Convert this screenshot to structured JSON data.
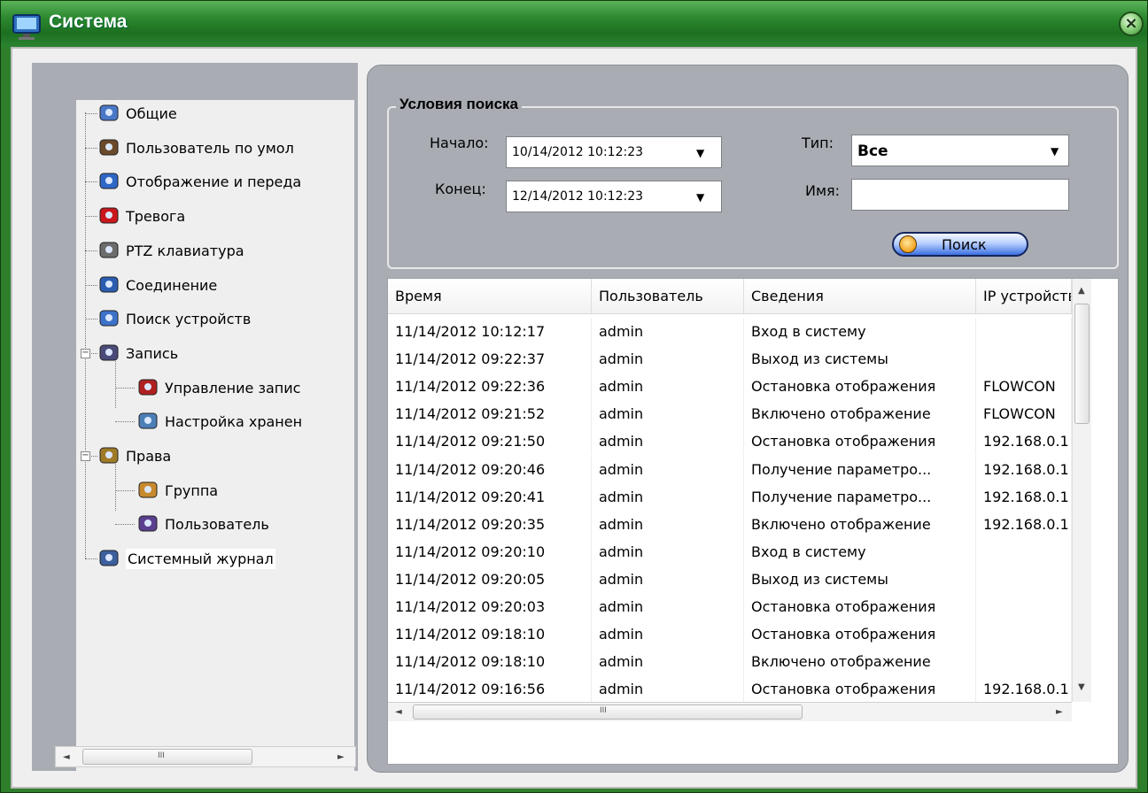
{
  "window": {
    "title": "Система",
    "close_glyph": "×",
    "icons": {
      "title": "monitor-icon",
      "close": "close-icon"
    }
  },
  "tree": {
    "items": [
      {
        "label": "Общие",
        "icon": "general-settings-icon"
      },
      {
        "label": "Пользователь по умол",
        "icon": "default-user-icon"
      },
      {
        "label": "Отображение и переда",
        "icon": "display-icon"
      },
      {
        "label": "Тревога",
        "icon": "alarm-icon"
      },
      {
        "label": "PTZ клавиатура",
        "icon": "ptz-keyboard-icon"
      },
      {
        "label": "Соединение",
        "icon": "connection-icon"
      },
      {
        "label": "Поиск устройств",
        "icon": "device-search-icon"
      },
      {
        "label": "Запись",
        "icon": "recording-icon",
        "expanded": true
      },
      {
        "label": "Управление запис",
        "icon": "record-control-icon"
      },
      {
        "label": "Настройка хранен",
        "icon": "storage-settings-icon"
      },
      {
        "label": "Права",
        "icon": "rights-icon",
        "expanded": true
      },
      {
        "label": "Группа",
        "icon": "group-icon"
      },
      {
        "label": "Пользователь",
        "icon": "user-icon"
      },
      {
        "label": "Системный журнал",
        "icon": "system-log-icon",
        "selected": true
      }
    ],
    "scroll_glyphs": {
      "left": "◄",
      "right": "►",
      "grip": "III"
    }
  },
  "search": {
    "legend": "Условия поиска",
    "start_label": "Начало:",
    "start_value": "10/14/2012  10:12:23",
    "end_label": "Конец:",
    "end_value": "12/14/2012  10:12:23",
    "type_label": "Тип:",
    "type_value": "Все",
    "name_label": "Имя:",
    "name_value": "",
    "button_label": "Поиск",
    "dropdown_glyph": "▼"
  },
  "log_table": {
    "columns": [
      "Время",
      "Пользователь",
      "Сведения",
      "IP устройства"
    ],
    "rows": [
      [
        "11/14/2012 10:12:17",
        "admin",
        "Вход в систему",
        ""
      ],
      [
        "11/14/2012 09:22:37",
        "admin",
        "Выход из системы",
        ""
      ],
      [
        "11/14/2012 09:22:36",
        "admin",
        "Остановка отображения",
        "FLOWCON"
      ],
      [
        "11/14/2012 09:21:52",
        "admin",
        "Включено отображение",
        "FLOWCON"
      ],
      [
        "11/14/2012 09:21:50",
        "admin",
        "Остановка отображения",
        "192.168.0.1"
      ],
      [
        "11/14/2012 09:20:46",
        "admin",
        "Получение параметро...",
        "192.168.0.1"
      ],
      [
        "11/14/2012 09:20:41",
        "admin",
        "Получение параметро...",
        "192.168.0.1"
      ],
      [
        "11/14/2012 09:20:35",
        "admin",
        "Включено отображение",
        "192.168.0.1"
      ],
      [
        "11/14/2012 09:20:10",
        "admin",
        "Вход в систему",
        ""
      ],
      [
        "11/14/2012 09:20:05",
        "admin",
        "Выход из системы",
        ""
      ],
      [
        "11/14/2012 09:20:03",
        "admin",
        "Остановка отображения",
        ""
      ],
      [
        "11/14/2012 09:18:10",
        "admin",
        "Остановка отображения",
        ""
      ],
      [
        "11/14/2012 09:18:10",
        "admin",
        "Включено отображение",
        ""
      ],
      [
        "11/14/2012 09:16:56",
        "admin",
        "Остановка отображения",
        "192.168.0.1"
      ]
    ],
    "scroll_glyphs": {
      "up": "▲",
      "down": "▼",
      "left": "◄",
      "right": "►",
      "grip": "III"
    }
  }
}
